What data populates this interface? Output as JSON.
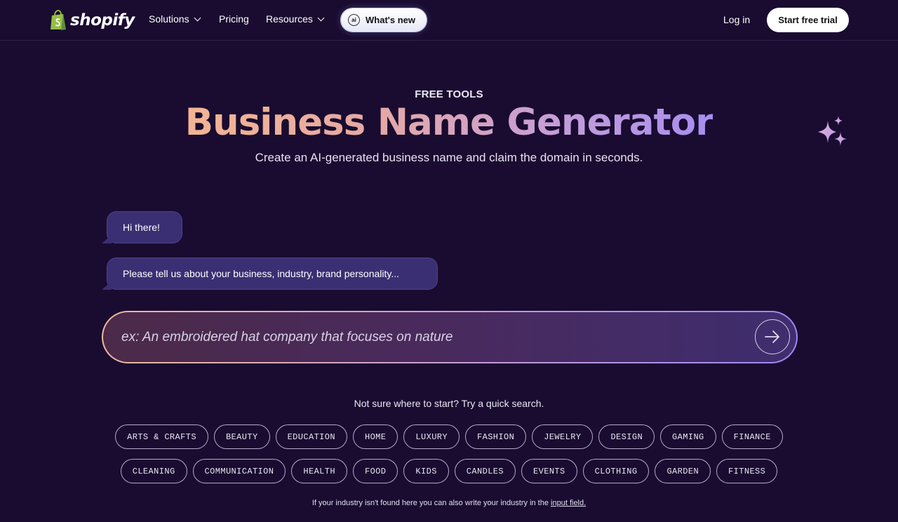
{
  "nav": {
    "logo_text": "shopify",
    "links": [
      {
        "label": "Solutions",
        "has_dropdown": true
      },
      {
        "label": "Pricing",
        "has_dropdown": false
      },
      {
        "label": "Resources",
        "has_dropdown": true
      }
    ],
    "whats_new_label": "What's new",
    "login_label": "Log in",
    "trial_label": "Start free trial"
  },
  "hero": {
    "eyebrow": "FREE TOOLS",
    "title": "Business Name Generator",
    "subtitle": "Create an AI-generated business name and claim the domain in seconds."
  },
  "chat": {
    "greeting": "Hi there!",
    "prompt": "Please tell us about your business, industry, brand personality..."
  },
  "input": {
    "value": "",
    "placeholder": "ex: An embroidered hat company that focuses on nature"
  },
  "quick_search": {
    "hint": "Not sure where to start? Try a quick search.",
    "row1": [
      "ARTS & CRAFTS",
      "BEAUTY",
      "EDUCATION",
      "HOME",
      "LUXURY",
      "FASHION",
      "JEWELRY",
      "DESIGN",
      "GAMING",
      "FINANCE"
    ],
    "row2": [
      "CLEANING",
      "COMMUNICATION",
      "HEALTH",
      "FOOD",
      "KIDS",
      "CANDLES",
      "EVENTS",
      "CLOTHING",
      "GARDEN",
      "FITNESS"
    ]
  },
  "footnote": {
    "text": "If your industry isn't found here you can also write your industry in the ",
    "link": "input field."
  },
  "colors": {
    "background": "#190c30",
    "bubble": "#3b2f73",
    "accent_start": "#f2b593",
    "accent_end": "#a88df0"
  }
}
